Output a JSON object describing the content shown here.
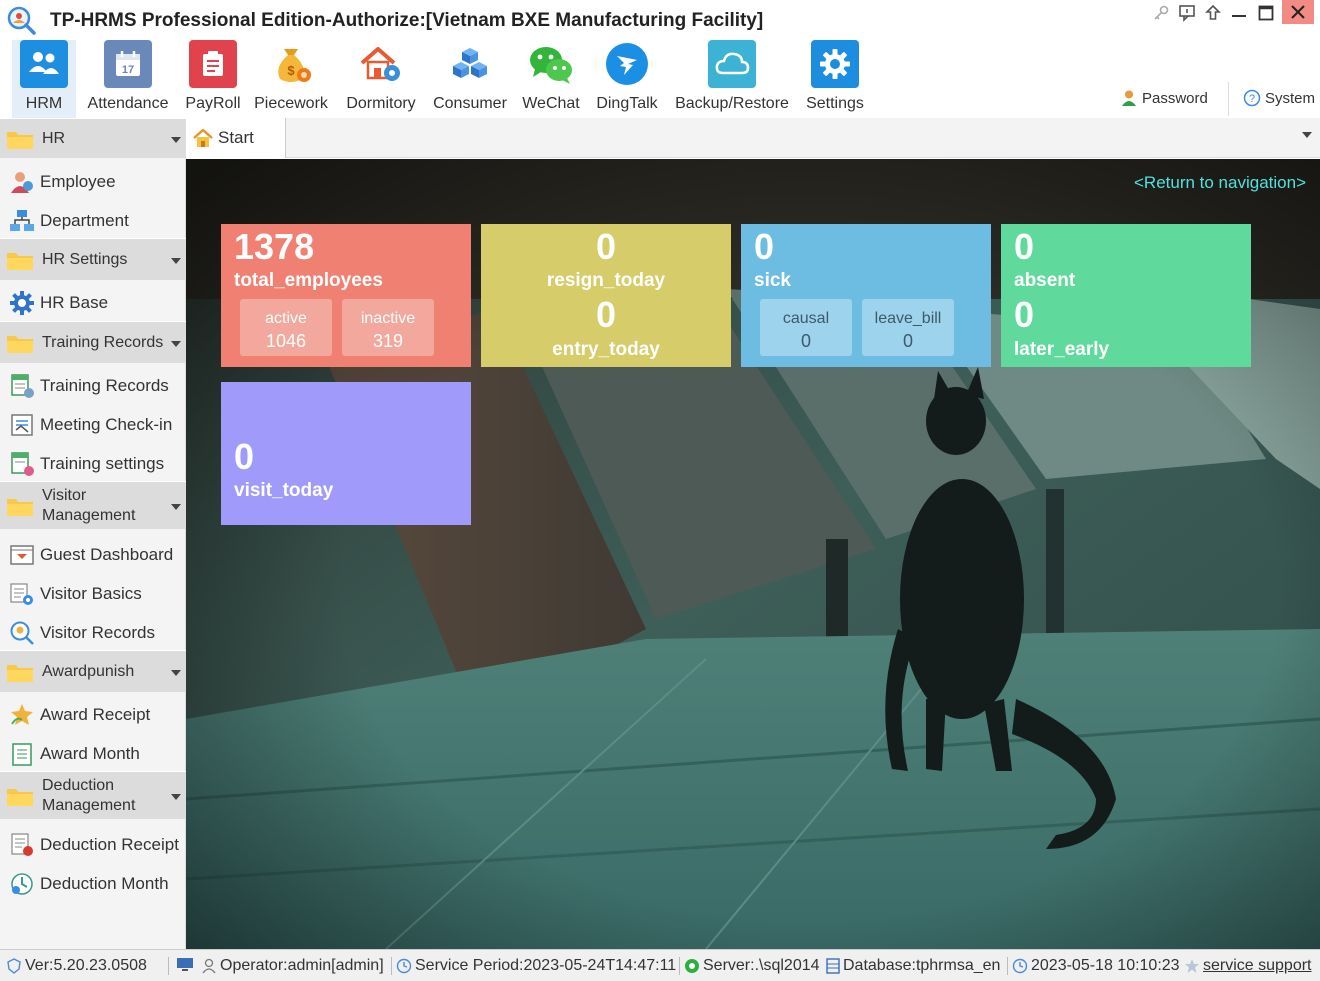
{
  "window": {
    "title": "TP-HRMS Professional Edition-Authorize:[Vietnam BXE Manufacturing Facility]",
    "controls": [
      "key-icon",
      "chat-icon",
      "pin-icon",
      "minimize-icon",
      "maximize-icon",
      "close-icon"
    ]
  },
  "ribbon": {
    "modules": [
      {
        "label": "HRM",
        "icon": "users-icon",
        "color": "#1e8fe0",
        "active": true
      },
      {
        "label": "Attendance",
        "icon": "calendar-icon",
        "color": "#6a88b8"
      },
      {
        "label": "PayRoll",
        "icon": "payroll-icon",
        "color": "#e0434b"
      },
      {
        "label": "Piecework",
        "icon": "money-bag-icon",
        "color": "#f2a623"
      },
      {
        "label": "Dormitory",
        "icon": "house-gear-icon",
        "color": "#e85b32"
      },
      {
        "label": "Consumer",
        "icon": "cubes-icon",
        "color": "#3d87d9"
      },
      {
        "label": "WeChat",
        "icon": "wechat-icon",
        "color": "#33b43a"
      },
      {
        "label": "DingTalk",
        "icon": "dingtalk-icon",
        "color": "#1b8fe4"
      },
      {
        "label": "Backup/Restore",
        "icon": "cloud-icon",
        "color": "#3cb3d5"
      },
      {
        "label": "Settings",
        "icon": "gear-icon",
        "color": "#1d8de0"
      }
    ],
    "password_label": "Password",
    "system_label": "System"
  },
  "tabs": {
    "start_label": "Start"
  },
  "sidebar": {
    "groups": {
      "hr": "HR",
      "hr_settings": "HR Settings",
      "training_records": "Training Records",
      "visitor_line1": "Visitor",
      "visitor_line2": "Management",
      "awardpunish": "Awardpunish",
      "deduction_line1": "Deduction",
      "deduction_line2": "Management"
    },
    "items": {
      "employee": "Employee",
      "department": "Department",
      "hr_base": "HR Base",
      "training_records": "Training Records",
      "meeting_checkin": "Meeting Check-in",
      "training_settings": "Training settings",
      "guest_dashboard": "Guest Dashboard",
      "visitor_basics": "Visitor Basics",
      "visitor_records": "Visitor Records",
      "award_receipt": "Award Receipt",
      "award_month": "Award Month",
      "deduction_receipt": "Deduction Receipt",
      "deduction_month": "Deduction Month"
    }
  },
  "dashboard": {
    "return_link": "<Return to navigation>",
    "employees": {
      "total": "1378",
      "total_label": "total_employees",
      "active_label": "active",
      "active": "1046",
      "inactive_label": "inactive",
      "inactive": "319",
      "color": "#f08172"
    },
    "resign": {
      "resign": "0",
      "resign_label": "resign_today",
      "entry": "0",
      "entry_label": "entry_today",
      "color": "#d6cc6a"
    },
    "sick": {
      "sick": "0",
      "sick_label": "sick",
      "causal_label": "causal",
      "causal": "0",
      "leave_label": "leave_bill",
      "leave": "0",
      "color": "#6dbde2"
    },
    "absent": {
      "absent": "0",
      "absent_label": "absent",
      "later": "0",
      "later_label": "later_early",
      "color": "#5fd99c"
    },
    "visit": {
      "visit": "0",
      "visit_label": "visit_today",
      "color": "#a09bfb"
    }
  },
  "statusbar": {
    "version": "Ver:5.20.23.0508",
    "operator": "Operator:admin[admin]",
    "service_period": "Service Period:2023-05-24T14:47:11",
    "server": "Server:.\\sql2014",
    "database": "Database:tphrmsa_en",
    "datetime": "2023-05-18 10:10:23",
    "support": "service support"
  }
}
